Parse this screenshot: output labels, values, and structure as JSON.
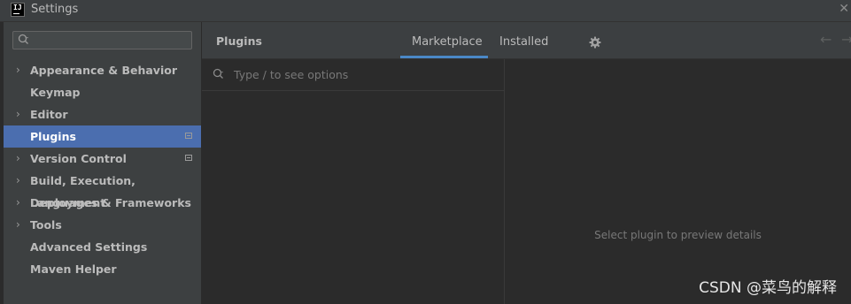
{
  "window": {
    "title": "Settings",
    "icon": "intellij-idea-icon"
  },
  "sidebar": {
    "search": {
      "placeholder": "",
      "icon": "search-icon"
    },
    "items": [
      {
        "label": "Appearance & Behavior",
        "expandable": true,
        "selected": false,
        "badge": false
      },
      {
        "label": "Keymap",
        "expandable": false,
        "selected": false,
        "badge": false
      },
      {
        "label": "Editor",
        "expandable": true,
        "selected": false,
        "badge": false
      },
      {
        "label": "Plugins",
        "expandable": false,
        "selected": true,
        "badge": true
      },
      {
        "label": "Version Control",
        "expandable": true,
        "selected": false,
        "badge": true
      },
      {
        "label": "Build, Execution, Deployment",
        "expandable": true,
        "selected": false,
        "badge": false
      },
      {
        "label": "Languages & Frameworks",
        "expandable": true,
        "selected": false,
        "badge": false
      },
      {
        "label": "Tools",
        "expandable": true,
        "selected": false,
        "badge": false
      },
      {
        "label": "Advanced Settings",
        "expandable": false,
        "selected": false,
        "badge": false
      },
      {
        "label": "Maven Helper",
        "expandable": false,
        "selected": false,
        "badge": false
      }
    ]
  },
  "main": {
    "title": "Plugins",
    "tabs": [
      {
        "label": "Marketplace",
        "active": true
      },
      {
        "label": "Installed",
        "active": false
      }
    ],
    "search": {
      "placeholder": "Type / to see options"
    },
    "details": {
      "empty_message": "Select plugin to preview details"
    }
  },
  "watermark": "CSDN @菜鸟的解释",
  "colors": {
    "selection": "#4b6eaf",
    "tab_underline": "#4a88c7",
    "background": "#2b2b2b",
    "panel": "#3c3f41"
  }
}
